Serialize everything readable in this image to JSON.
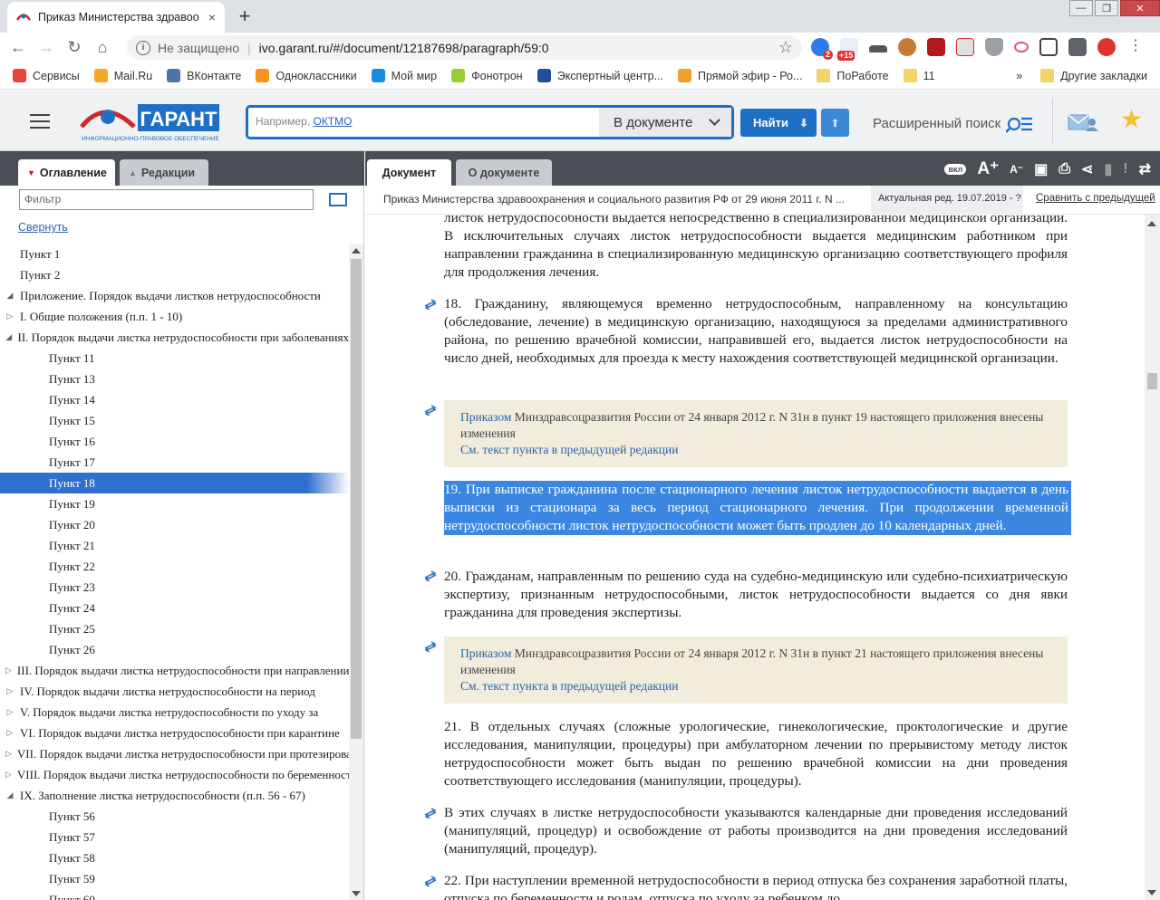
{
  "browser": {
    "tab_title": "Приказ Министерства здравоо",
    "tab_close": "×",
    "new_tab": "+",
    "address": {
      "security": "Не защищено",
      "url": "ivo.garant.ru/#/document/12187698/paragraph/59:0"
    },
    "bookmarks": [
      {
        "label": "Сервисы",
        "color": "#e8453c"
      },
      {
        "label": "Mail.Ru",
        "color": "#f5a623"
      },
      {
        "label": "ВКонтакте",
        "color": "#4a76a8"
      },
      {
        "label": "Одноклассники",
        "color": "#f7931e"
      },
      {
        "label": "Мой мир",
        "color": "#168de2"
      },
      {
        "label": "Фонотрон",
        "color": "#9acd32"
      },
      {
        "label": "Экспертный центр...",
        "color": "#1f4e9c"
      },
      {
        "label": "Прямой эфир - Ро...",
        "color": "#f0a030"
      },
      {
        "label": "ПоРаботе",
        "color": "#f4d36a"
      },
      {
        "label": "11",
        "color": "#f4d36a"
      }
    ],
    "bookmarks_more": "»",
    "other_bookmarks": "Другие закладки",
    "ext_badges": [
      "2",
      "+15"
    ]
  },
  "garant": {
    "logo_text": "ГАРАНТ",
    "logo_sub": "ИНФОРМАЦИОННО-ПРАВОВОЕ ОБЕСПЕЧЕНИЕ",
    "search_placeholder_prefix": "Например, ",
    "search_placeholder_link": "ОКТМО",
    "search_scope": "В документе",
    "find_label": "Найти",
    "advanced_search": "Расширенный поиск"
  },
  "left_panel": {
    "tabs": [
      "Оглавление",
      "Редакции"
    ],
    "filter_placeholder": "Фильтр",
    "collapse_label": "Свернуть",
    "tree": [
      {
        "label": "Пункт 1",
        "level": 0,
        "toggle": ""
      },
      {
        "label": "Пункт 2",
        "level": 0,
        "toggle": ""
      },
      {
        "label": "Приложение. Порядок выдачи листков нетрудоспособности",
        "level": 0,
        "toggle": "◢"
      },
      {
        "label": "I. Общие положения (п.п. 1 - 10)",
        "level": 1,
        "toggle": "▷"
      },
      {
        "label": "II. Порядок выдачи листка нетрудоспособности при заболеваниях",
        "level": 1,
        "toggle": "◢"
      },
      {
        "label": "Пункт 11",
        "level": 2,
        "toggle": ""
      },
      {
        "label": "Пункт 13",
        "level": 2,
        "toggle": ""
      },
      {
        "label": "Пункт 14",
        "level": 2,
        "toggle": ""
      },
      {
        "label": "Пункт 15",
        "level": 2,
        "toggle": ""
      },
      {
        "label": "Пункт 16",
        "level": 2,
        "toggle": ""
      },
      {
        "label": "Пункт 17",
        "level": 2,
        "toggle": ""
      },
      {
        "label": "Пункт 18",
        "level": 2,
        "toggle": "",
        "selected": true
      },
      {
        "label": "Пункт 19",
        "level": 2,
        "toggle": ""
      },
      {
        "label": "Пункт 20",
        "level": 2,
        "toggle": ""
      },
      {
        "label": "Пункт 21",
        "level": 2,
        "toggle": ""
      },
      {
        "label": "Пункт 22",
        "level": 2,
        "toggle": ""
      },
      {
        "label": "Пункт 23",
        "level": 2,
        "toggle": ""
      },
      {
        "label": "Пункт 24",
        "level": 2,
        "toggle": ""
      },
      {
        "label": "Пункт 25",
        "level": 2,
        "toggle": ""
      },
      {
        "label": "Пункт 26",
        "level": 2,
        "toggle": ""
      },
      {
        "label": "III. Порядок выдачи листка нетрудоспособности при направлении",
        "level": 1,
        "toggle": "▷"
      },
      {
        "label": "IV. Порядок выдачи листка нетрудоспособности на период",
        "level": 1,
        "toggle": "▷"
      },
      {
        "label": "V. Порядок выдачи листка нетрудоспособности по уходу за",
        "level": 1,
        "toggle": "▷"
      },
      {
        "label": "VI. Порядок выдачи листка нетрудоспособности при карантине",
        "level": 1,
        "toggle": "▷"
      },
      {
        "label": "VII. Порядок выдачи листка нетрудоспособности при протезировании",
        "level": 1,
        "toggle": "▷"
      },
      {
        "label": "VIII. Порядок выдачи листка нетрудоспособности по беременности",
        "level": 1,
        "toggle": "▷"
      },
      {
        "label": "IX. Заполнение листка нетрудоспособности (п.п. 56 - 67)",
        "level": 1,
        "toggle": "◢"
      },
      {
        "label": "Пункт 56",
        "level": 2,
        "toggle": ""
      },
      {
        "label": "Пункт 57",
        "level": 2,
        "toggle": ""
      },
      {
        "label": "Пункт 58",
        "level": 2,
        "toggle": ""
      },
      {
        "label": "Пункт 59",
        "level": 2,
        "toggle": ""
      },
      {
        "label": "Пункт 60",
        "level": 2,
        "toggle": ""
      }
    ]
  },
  "right_panel": {
    "tabs": [
      "Документ",
      "О документе"
    ],
    "tool_label_on": "вкл",
    "doc_title": "Приказ Министерства здравоохранения и социального развития РФ от 29 июня 2011 г. N ...",
    "actual_edition": "Актуальная ред. 19.07.2019 - ?",
    "compare_link": "Сравнить с предыдущей"
  },
  "document": {
    "p_top": "листок нетрудоспособности выдается непосредственно в специализированной медицинской организации. В исключительных случаях листок нетрудоспособности выдается медицинским работником при направлении гражданина в специализированную медицинскую организацию соответствующего профиля для продолжения лечения.",
    "p18": "18. Гражданину, являющемуся временно нетрудоспособным, направленному на консультацию (обследование, лечение) в медицинскую организацию, находящуюся за пределами административного района, по решению врачебной комиссии, направившей его, выдается листок нетрудоспособности на число дней, необходимых для проезда к месту нахождения соответствующей медицинской организации.",
    "note1": {
      "link": "Приказом",
      "text": " Минздравсоцразвития России от 24 января 2012 г. N 31н в пункт 19 настоящего приложения внесены изменения",
      "prev": "См. текст пункта в предыдущей редакции"
    },
    "p19": "19. При выписке гражданина после стационарного лечения листок нетрудоспособности выдается в день выписки из стационара за весь период стационарного лечения. При продолжении временной нетрудоспособности листок нетрудоспособности может быть продлен до 10 календарных дней.",
    "p20": "20. Гражданам, направленным по решению суда на судебно-медицинскую или судебно-психиатрическую экспертизу, признанным нетрудоспособными, листок нетрудоспособности выдается со дня явки гражданина для проведения экспертизы.",
    "note2": {
      "link": "Приказом",
      "text": " Минздравсоцразвития России от 24 января 2012 г. N 31н в пункт 21 настоящего приложения внесены изменения",
      "prev": "См. текст пункта в предыдущей редакции"
    },
    "p21": "21. В отдельных случаях (сложные урологические, гинекологические, проктологические и другие исследования, манипуляции, процедуры) при амбулаторном лечении по прерывистому методу листок нетрудоспособности может быть выдан по решению врачебной комиссии на дни проведения соответствующего исследования (манипуляции, процедуры).",
    "p21b": "В этих случаях в листке нетрудоспособности указываются календарные дни проведения исследований (манипуляций, процедур) и освобождение от работы производится на дни проведения исследований (манипуляций, процедур).",
    "p22": "22. При наступлении временной нетрудоспособности в период отпуска без сохранения заработной платы, отпуска по беременности и родам, отпуска по уходу за ребенком до"
  },
  "colors": {
    "accent": "#1f6fc4",
    "selection": "#3b86e0",
    "note_bg": "#f1ecdb",
    "panel_dark": "#4b4f55"
  }
}
